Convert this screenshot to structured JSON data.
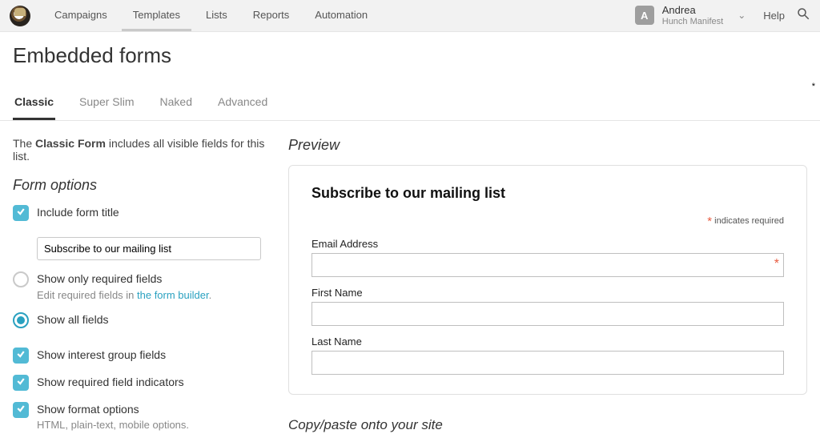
{
  "nav": {
    "items": [
      "Campaigns",
      "Templates",
      "Lists",
      "Reports",
      "Automation"
    ]
  },
  "account": {
    "initial": "A",
    "name": "Andrea",
    "org": "Hunch Manifest"
  },
  "help": "Help",
  "page_title": "Embedded forms",
  "tabs": [
    "Classic",
    "Super Slim",
    "Naked",
    "Advanced"
  ],
  "active_tab": 0,
  "description_prefix": "The ",
  "description_bold": "Classic Form",
  "description_suffix": " includes all visible fields for this list.",
  "form_options_heading": "Form options",
  "options": {
    "include_title": "Include form title",
    "title_value": "Subscribe to our mailing list",
    "only_required": "Show only required fields",
    "only_required_sub_prefix": "Edit required fields in ",
    "only_required_link": "the form builder",
    "show_all": "Show all fields",
    "interest": "Show interest group fields",
    "req_ind": "Show required field indicators",
    "format": "Show format options",
    "format_sub": "HTML, plain-text, mobile options."
  },
  "preview_heading": "Preview",
  "preview": {
    "title": "Subscribe to our mailing list",
    "required_note": "indicates required",
    "fields": {
      "email": "Email Address",
      "first": "First Name",
      "last": "Last Name"
    }
  },
  "copy_heading": "Copy/paste onto your site"
}
